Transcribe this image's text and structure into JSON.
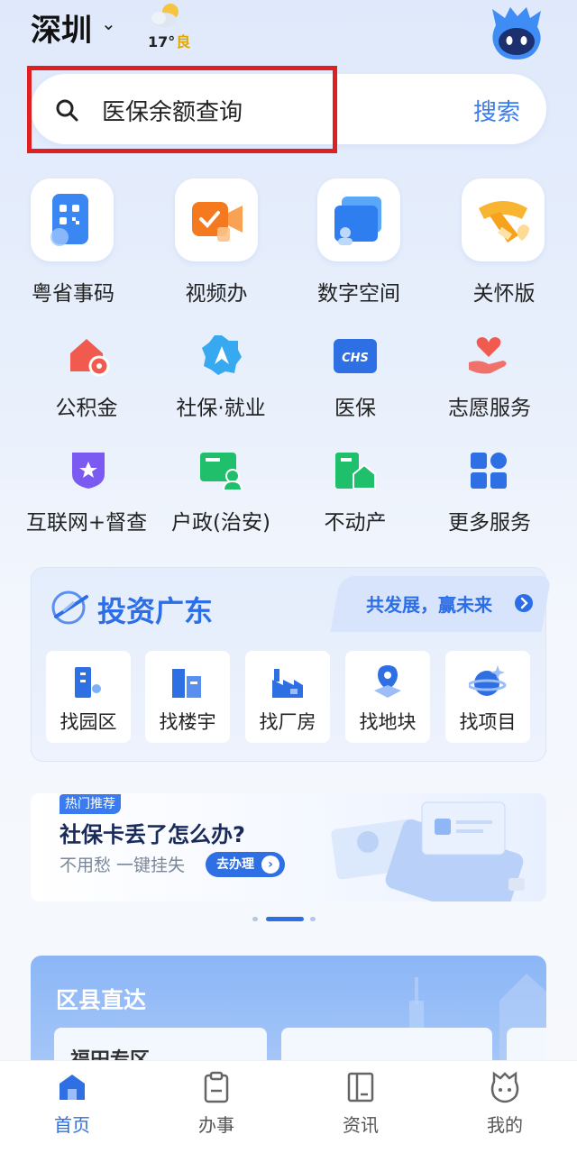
{
  "header": {
    "city": "深圳",
    "weather_temp": "17°",
    "weather_quality": "良"
  },
  "search": {
    "query": "医保余额查询",
    "button_label": "搜索"
  },
  "top_tiles": [
    {
      "label": "粤省事码",
      "icon": "qr-code-icon"
    },
    {
      "label": "视频办",
      "icon": "video-camera-icon"
    },
    {
      "label": "数字空间",
      "icon": "folder-icon"
    },
    {
      "label": "关怀版",
      "icon": "scarf-icon"
    }
  ],
  "services": [
    {
      "label": "公积金",
      "icon": "house-coin-icon"
    },
    {
      "label": "社保·就业",
      "icon": "social-security-icon"
    },
    {
      "label": "医保",
      "icon": "chs-icon",
      "icon_text": "CHS"
    },
    {
      "label": "志愿服务",
      "icon": "heart-hand-icon"
    },
    {
      "label": "互联网+督查",
      "icon": "shield-star-icon"
    },
    {
      "label": "户政(治安)",
      "icon": "id-card-icon"
    },
    {
      "label": "不动产",
      "icon": "building-icon"
    },
    {
      "label": "更多服务",
      "icon": "grid-icon"
    }
  ],
  "invest": {
    "title": "投资广东",
    "slogan": "共发展，赢未来",
    "items": [
      {
        "label": "找园区",
        "icon": "park-icon"
      },
      {
        "label": "找楼宇",
        "icon": "tower-icon"
      },
      {
        "label": "找厂房",
        "icon": "factory-icon"
      },
      {
        "label": "找地块",
        "icon": "map-pin-icon"
      },
      {
        "label": "找项目",
        "icon": "planet-icon"
      }
    ]
  },
  "banner": {
    "tag": "热门推荐",
    "title": "社保卡丢了怎么办?",
    "subtitle": "不用愁 一键挂失",
    "button": "去办理"
  },
  "district": {
    "title": "区县直达",
    "first_item": "福田专区"
  },
  "bottom_nav": [
    {
      "label": "首页",
      "icon": "home-icon",
      "active": true
    },
    {
      "label": "办事",
      "icon": "clipboard-icon",
      "active": false
    },
    {
      "label": "资讯",
      "icon": "book-icon",
      "active": false
    },
    {
      "label": "我的",
      "icon": "mascot-face-icon",
      "active": false
    }
  ],
  "colors": {
    "accent": "#2f6fe4",
    "search_highlight": "#e02020"
  }
}
